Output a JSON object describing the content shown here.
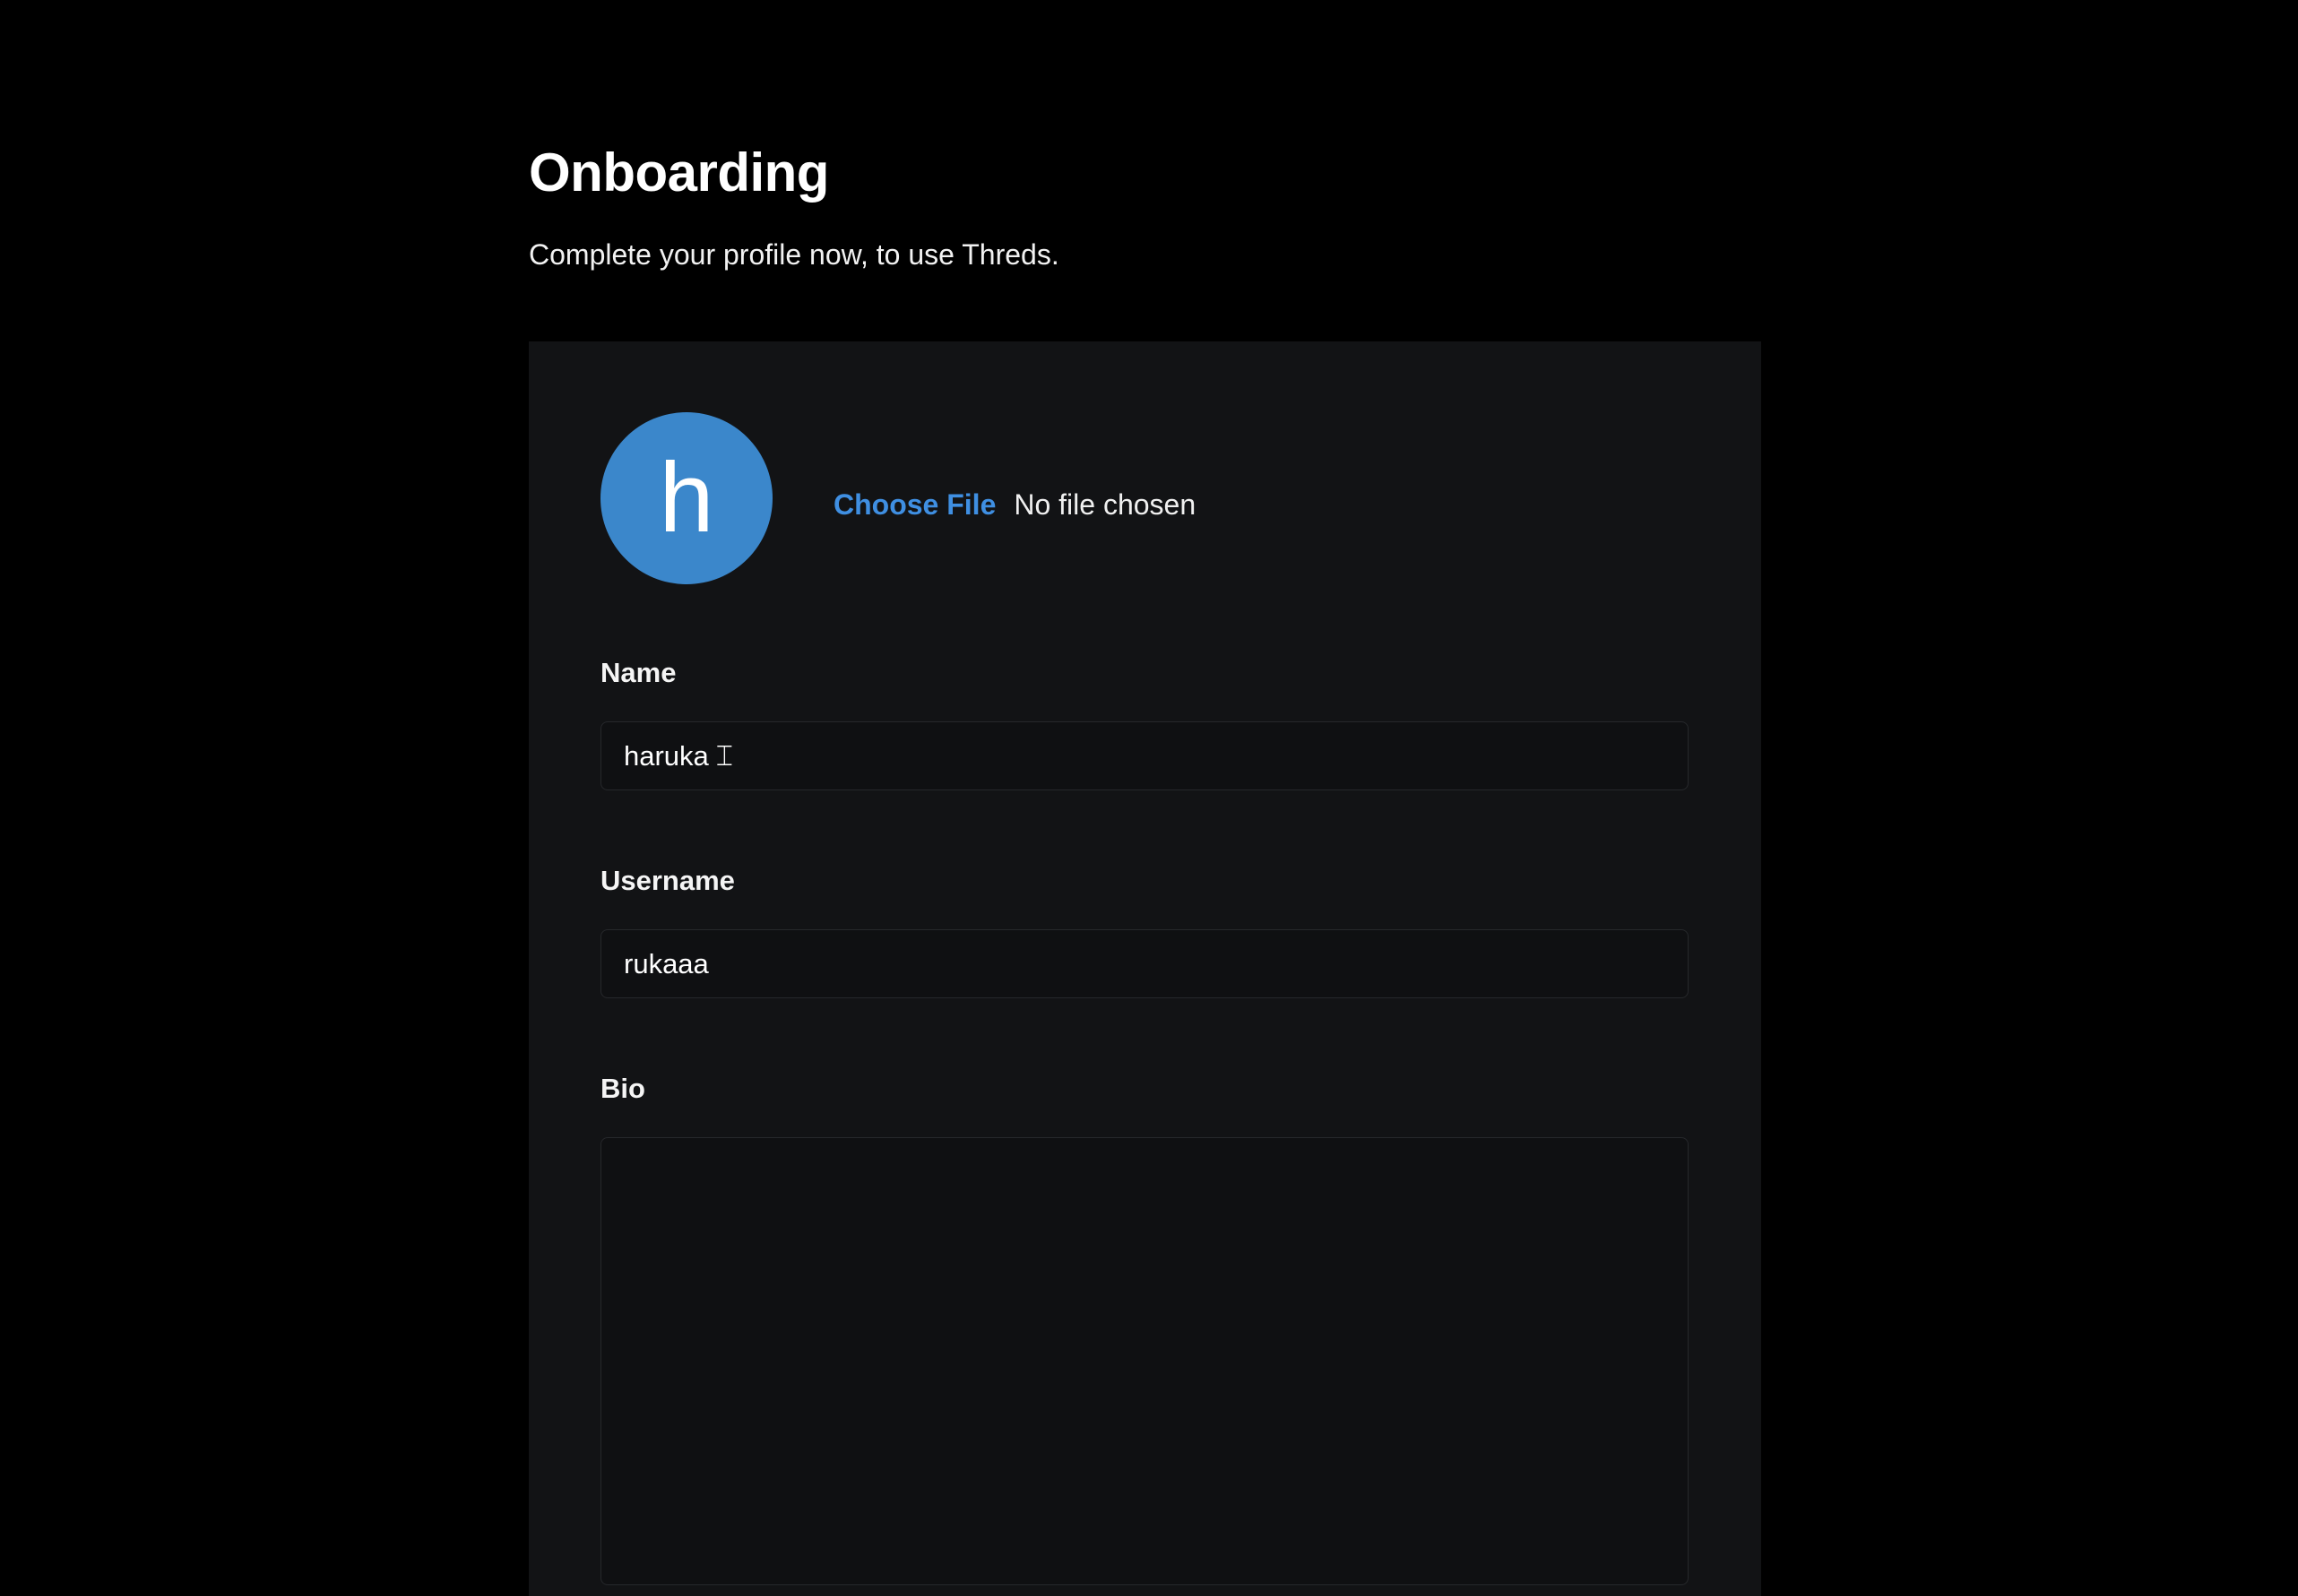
{
  "header": {
    "title": "Onboarding",
    "subtitle": "Complete your profile now, to use Threds."
  },
  "profile": {
    "avatar_letter": "h",
    "avatar_color": "#3b87cb",
    "choose_file_label": "Choose File",
    "file_status": "No file chosen"
  },
  "form": {
    "name_label": "Name",
    "name_value": "haruka",
    "username_label": "Username",
    "username_value": "rukaaa",
    "bio_label": "Bio",
    "bio_value": ""
  }
}
